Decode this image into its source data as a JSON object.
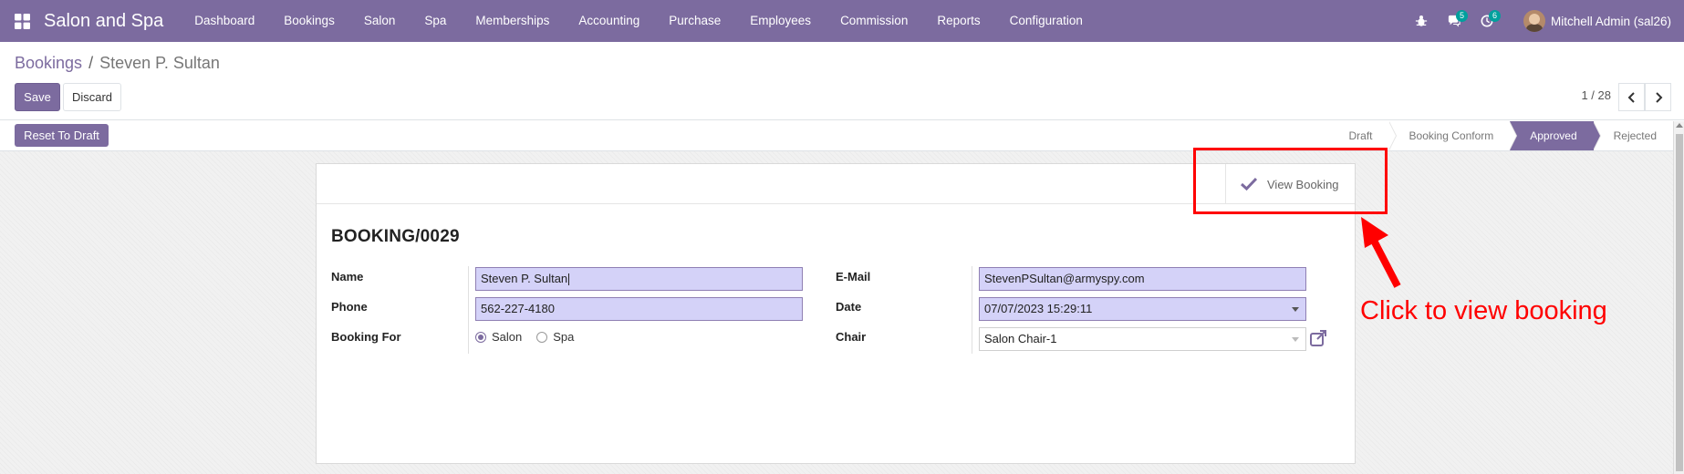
{
  "navbar": {
    "brand": "Salon and Spa",
    "menu": [
      "Dashboard",
      "Bookings",
      "Salon",
      "Spa",
      "Memberships",
      "Accounting",
      "Purchase",
      "Employees",
      "Commission",
      "Reports",
      "Configuration"
    ],
    "messages_count": "5",
    "activities_count": "6",
    "user_name": "Mitchell Admin (sal26)"
  },
  "control_panel": {
    "breadcrumb_parent": "Bookings",
    "breadcrumb_separator": "/",
    "breadcrumb_current": "Steven P. Sultan",
    "save_label": "Save",
    "discard_label": "Discard",
    "pager": "1 / 28"
  },
  "statusbar": {
    "reset_label": "Reset To Draft",
    "stages": [
      "Draft",
      "Booking Conform",
      "Approved",
      "Rejected"
    ],
    "active_stage": "Approved"
  },
  "form": {
    "view_booking_label": "View Booking",
    "title": "BOOKING/0029",
    "name_label": "Name",
    "name_value": "Steven P. Sultan",
    "phone_label": "Phone",
    "phone_value": "562-227-4180",
    "booking_for_label": "Booking For",
    "booking_for_options": [
      "Salon",
      "Spa"
    ],
    "booking_for_selected": "Salon",
    "email_label": "E-Mail",
    "email_value": "StevenPSultan@armyspy.com",
    "date_label": "Date",
    "date_value": "07/07/2023 15:29:11",
    "chair_label": "Chair",
    "chair_value": "Salon Chair-1"
  },
  "annotation": {
    "text": "Click to view booking",
    "color": "#ff0000"
  },
  "colors": {
    "brand": "#7c6b9f",
    "badge": "#00a09d",
    "input_highlight": "#d4d2f8"
  }
}
